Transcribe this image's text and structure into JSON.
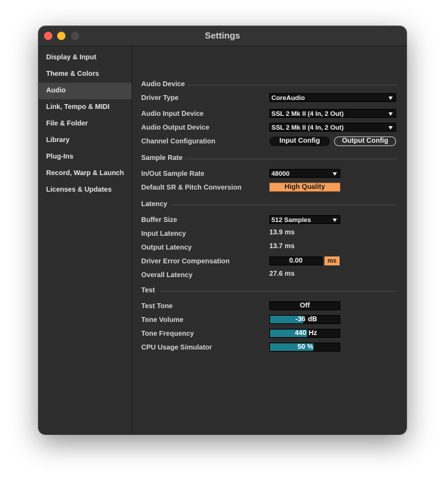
{
  "window": {
    "title": "Settings"
  },
  "sidebar": {
    "items": [
      {
        "label": "Display & Input"
      },
      {
        "label": "Theme & Colors"
      },
      {
        "label": "Audio"
      },
      {
        "label": "Link, Tempo & MIDI"
      },
      {
        "label": "File & Folder"
      },
      {
        "label": "Library"
      },
      {
        "label": "Plug-Ins"
      },
      {
        "label": "Record, Warp & Launch"
      },
      {
        "label": "Licenses & Updates"
      }
    ],
    "active": "Audio"
  },
  "audio_device": {
    "section": "Audio Device",
    "driver_type_label": "Driver Type",
    "driver_type_value": "CoreAudio",
    "input_device_label": "Audio Input Device",
    "input_device_value": "SSL 2 Mk II (4 In, 2 Out)",
    "output_device_label": "Audio Output Device",
    "output_device_value": "SSL 2 Mk II (4 In, 2 Out)",
    "channel_config_label": "Channel Configuration",
    "input_config_button": "Input Config",
    "output_config_button": "Output Config"
  },
  "sample_rate": {
    "section": "Sample Rate",
    "rate_label": "In/Out Sample Rate",
    "rate_value": "48000",
    "conversion_label": "Default SR & Pitch Conversion",
    "conversion_value": "High Quality"
  },
  "latency": {
    "section": "Latency",
    "buffer_label": "Buffer Size",
    "buffer_value": "512 Samples",
    "input_latency_label": "Input Latency",
    "input_latency_value": "13.9 ms",
    "output_latency_label": "Output Latency",
    "output_latency_value": "13.7 ms",
    "driver_comp_label": "Driver Error Compensation",
    "driver_comp_value": "0.00",
    "driver_comp_unit": "ms",
    "overall_label": "Overall Latency",
    "overall_value": "27.6 ms"
  },
  "test": {
    "section": "Test",
    "tone_label": "Test Tone",
    "tone_value": "Off",
    "volume_label": "Tone Volume",
    "volume_value": "-36",
    "volume_unit": "dB",
    "volume_fill_fraction": 0.48,
    "frequency_label": "Tone Frequency",
    "frequency_value": "440",
    "frequency_unit": "Hz",
    "frequency_fill_fraction": 0.53,
    "cpu_label": "CPU Usage Simulator",
    "cpu_value": "50 %",
    "cpu_fill_fraction": 0.62
  },
  "colors": {
    "accent_orange": "#f5a05a",
    "slider_teal": "#1d7f8e",
    "window_bg": "#2d2d2d",
    "close": "#ff5f57",
    "minimize": "#febc2e"
  }
}
